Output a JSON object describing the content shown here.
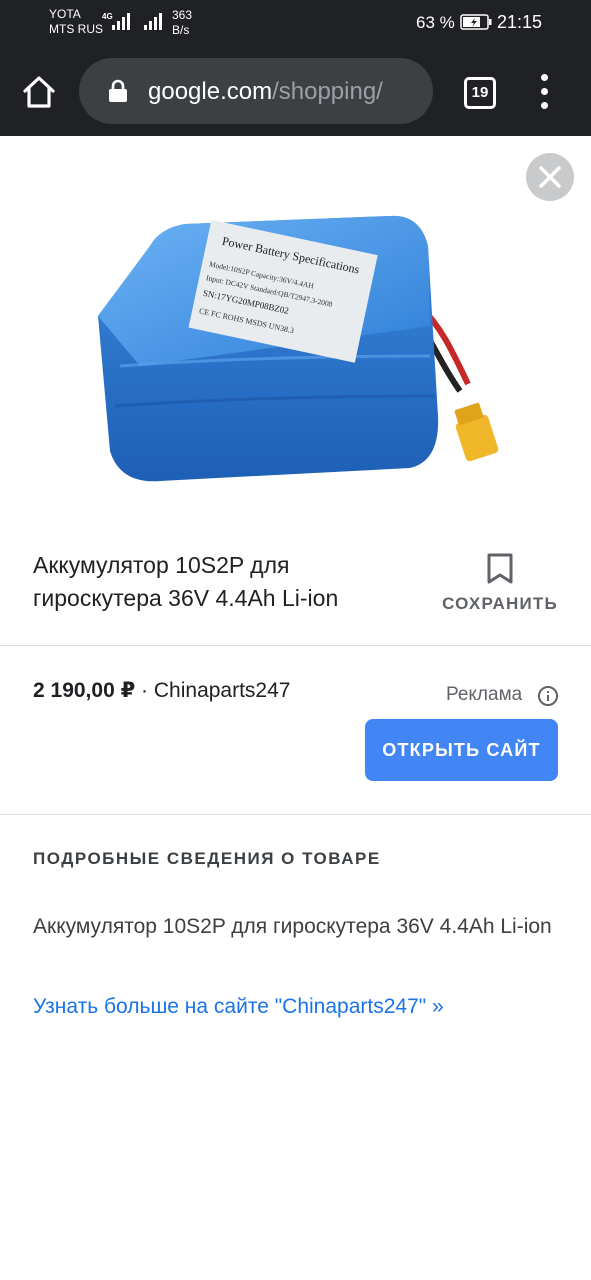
{
  "status_bar": {
    "carrier_1": "YOTA",
    "carrier_2": "MTS RUS",
    "network_type": "4G",
    "speed_value": "363",
    "speed_unit": "B/s",
    "battery_percent": "63 %",
    "time": "21:15"
  },
  "browser": {
    "url_domain": "google.com",
    "url_path": "/shopping/",
    "tab_count": "19"
  },
  "product": {
    "image_label_title": "Power Battery Specifications",
    "image_label_line1": "Model:10S2P   Capacity:36V/4.4AH",
    "image_label_line2": "Input: DC42V   Standard:QB/T2947.3-2008",
    "image_label_line3": "SN:17YG20MP08BZ02",
    "image_label_line4": "CE FC  ROHS  MSDS  UN38.3",
    "title": "Аккумулятор 10S2P для гироскутера 36V 4.4Ah Li-ion",
    "save_label": "СОХРАНИТЬ"
  },
  "offer": {
    "price": "2 190,00 ₽",
    "separator": " · ",
    "seller": "Chinaparts247",
    "ad_label": "Реклама",
    "open_site_label": "ОТКРЫТЬ САЙТ"
  },
  "details": {
    "heading": "ПОДРОБНЫЕ СВЕДЕНИЯ О ТОВАРЕ",
    "description": "Аккумулятор 10S2P для гироскутера 36V 4.4Ah Li-ion",
    "learn_more": "Узнать больше на сайте \"Chinaparts247\" »"
  },
  "colors": {
    "toolbar_bg": "#202124",
    "url_bar_bg": "#3c4043",
    "accent": "#4285f4",
    "link": "#1a73e8"
  }
}
